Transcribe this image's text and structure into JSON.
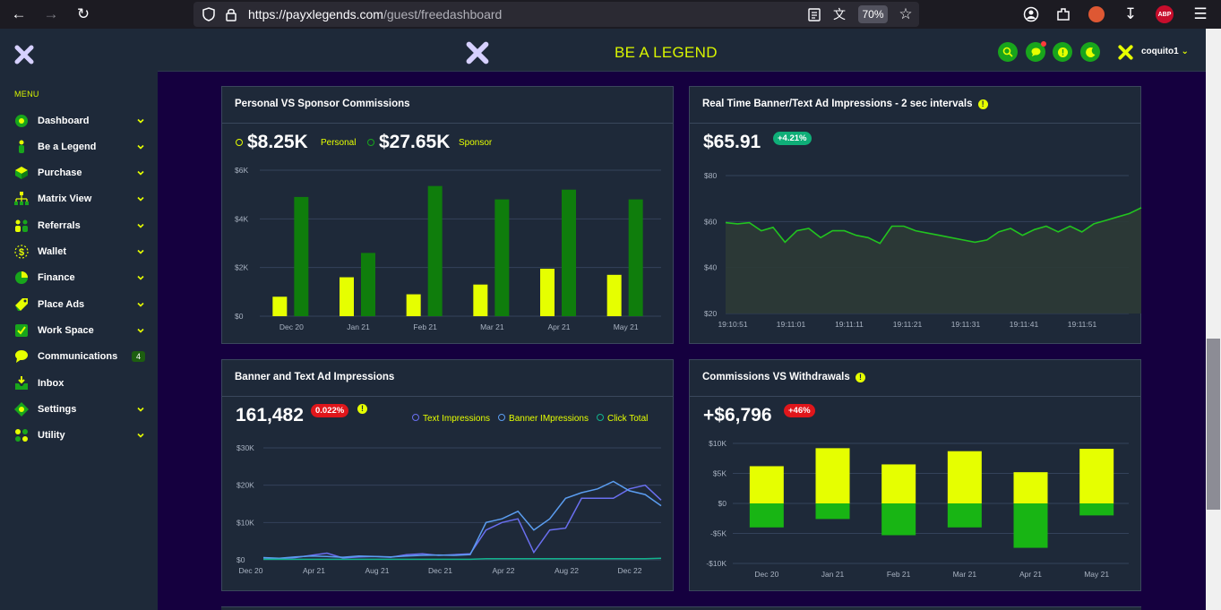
{
  "browser": {
    "url_host": "https://payxlegends.com",
    "url_path": "/guest/freedashboard",
    "zoom": "70%",
    "ext_badge": "ABP"
  },
  "header": {
    "brand": "BE A LEGEND",
    "username": "coquito1"
  },
  "sidebar": {
    "menu_label": "MENU",
    "items": [
      {
        "label": "Dashboard",
        "icon": "dashboard-icon",
        "chevron": true
      },
      {
        "label": "Be a Legend",
        "icon": "person-icon",
        "chevron": true
      },
      {
        "label": "Purchase",
        "icon": "cube-icon",
        "chevron": true
      },
      {
        "label": "Matrix View",
        "icon": "matrix-icon",
        "chevron": true
      },
      {
        "label": "Referrals",
        "icon": "referrals-icon",
        "chevron": true
      },
      {
        "label": "Wallet",
        "icon": "wallet-icon",
        "chevron": true
      },
      {
        "label": "Finance",
        "icon": "pie-icon",
        "chevron": true
      },
      {
        "label": "Place Ads",
        "icon": "tag-icon",
        "chevron": true
      },
      {
        "label": "Work Space",
        "icon": "checkbox-icon",
        "chevron": true
      },
      {
        "label": "Communications",
        "icon": "chat-icon",
        "badge": "4"
      },
      {
        "label": "Inbox",
        "icon": "inbox-icon"
      },
      {
        "label": "Settings",
        "icon": "settings-icon",
        "chevron": true
      },
      {
        "label": "Utility",
        "icon": "utility-icon",
        "chevron": true
      }
    ]
  },
  "colors": {
    "accent_yellow": "#e6ff00",
    "accent_green": "#18a51c",
    "card_bg": "#1e2939",
    "page_bg": "#15003f"
  },
  "cards": {
    "personal": {
      "title": "Personal VS Sponsor Commissions",
      "personal_value": "$8.25K",
      "personal_label": "Personal",
      "sponsor_value": "$27.65K",
      "sponsor_label": "Sponsor"
    },
    "realtime": {
      "title": "Real Time Banner/Text Ad Impressions - 2 sec intervals",
      "value": "$65.91",
      "change": "+4.21%"
    },
    "impressions": {
      "title": "Banner and Text Ad Impressions",
      "value": "161,482",
      "change": "0.022%",
      "legend": [
        "Text Impressions",
        "Banner IMpressions",
        "Click Total"
      ]
    },
    "withdrawals": {
      "title": "Commissions VS Withdrawals",
      "value": "+$6,796",
      "change": "+46%"
    }
  },
  "chart_data": [
    {
      "type": "bar",
      "categories": [
        "Dec 20",
        "Jan 21",
        "Feb 21",
        "Mar 21",
        "Apr 21",
        "May 21"
      ],
      "series": [
        {
          "name": "Personal",
          "values": [
            800,
            1600,
            900,
            1300,
            1950,
            1700
          ]
        },
        {
          "name": "Sponsor",
          "values": [
            4900,
            2600,
            5350,
            4800,
            5200,
            4800
          ]
        }
      ],
      "yticks": [
        "$0",
        "$2K",
        "$4K",
        "$6K"
      ],
      "ylim": [
        0,
        6000
      ]
    },
    {
      "type": "area",
      "x": [
        "19:10:51",
        "19:11:01",
        "19:11:11",
        "19:11:21",
        "19:11:31",
        "19:11:41",
        "19:11:51"
      ],
      "values": [
        59.5,
        59,
        59.5,
        56,
        57.5,
        51,
        56,
        57,
        53,
        56,
        56,
        54,
        53,
        50.5,
        58,
        58,
        56,
        55,
        54,
        53,
        52,
        51,
        52,
        55.5,
        57,
        54,
        56.5,
        58,
        55.5,
        58,
        55.5,
        59,
        60.5,
        62,
        63.5,
        66
      ],
      "yticks": [
        "$20",
        "$40",
        "$60",
        "$80"
      ],
      "ylim": [
        20,
        80
      ]
    },
    {
      "type": "line",
      "x": [
        "Dec 20",
        "Apr 21",
        "Aug 21",
        "Dec 21",
        "Apr 22",
        "Aug 22",
        "Dec 22"
      ],
      "series": [
        {
          "name": "Text Impressions",
          "values": [
            500,
            300,
            600,
            1200,
            1800,
            500,
            800,
            900,
            700,
            1400,
            1600,
            1200,
            1400,
            1600,
            8000,
            10000,
            11000,
            2000,
            8000,
            8500,
            16500,
            16500,
            16500,
            19000,
            20000,
            16000
          ]
        },
        {
          "name": "Banner IMpressions",
          "values": [
            600,
            400,
            800,
            1000,
            900,
            700,
            1000,
            900,
            800,
            1000,
            1200,
            1300,
            1200,
            1400,
            10000,
            11000,
            13000,
            8000,
            11000,
            16500,
            18000,
            19000,
            21000,
            18500,
            17500,
            14500
          ]
        },
        {
          "name": "Click Total",
          "values": [
            150,
            150,
            150,
            150,
            150,
            150,
            150,
            150,
            150,
            150,
            150,
            150,
            150,
            150,
            300,
            300,
            300,
            300,
            300,
            300,
            300,
            300,
            300,
            300,
            300,
            400
          ]
        }
      ],
      "yticks": [
        "$0",
        "$10K",
        "$20K",
        "$30K"
      ],
      "ylim": [
        0,
        30000
      ]
    },
    {
      "type": "bar",
      "categories": [
        "Dec 20",
        "Jan 21",
        "Feb 21",
        "Mar 21",
        "Apr 21",
        "May 21"
      ],
      "series": [
        {
          "name": "Commissions",
          "values": [
            6200,
            9200,
            6500,
            8700,
            5200,
            9100
          ]
        },
        {
          "name": "Withdrawals",
          "values": [
            -4000,
            -2600,
            -5300,
            -4000,
            -7400,
            -2000
          ]
        }
      ],
      "yticks": [
        "-$10K",
        "-$5K",
        "$0",
        "$5K",
        "$10K"
      ],
      "ylim": [
        -10000,
        10000
      ]
    }
  ]
}
